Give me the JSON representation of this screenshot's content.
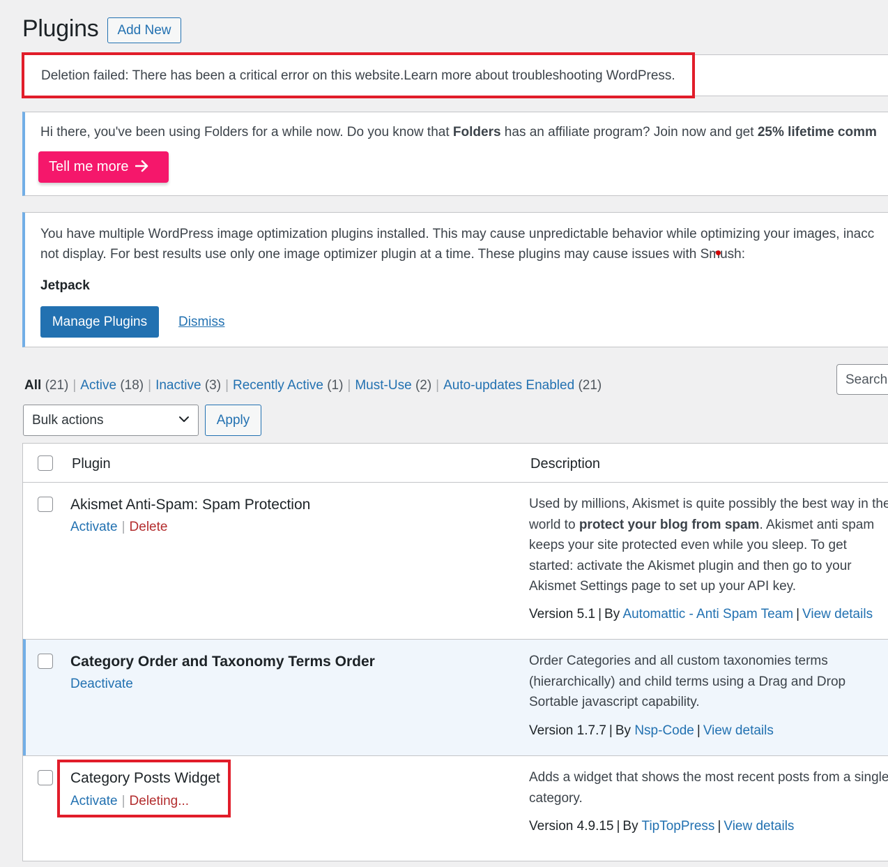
{
  "header": {
    "title": "Plugins",
    "add_new": "Add New"
  },
  "notices": {
    "error": {
      "text": "Deletion failed: There has been a critical error on this website.Learn more about troubleshooting WordPress."
    },
    "folders": {
      "text_a": "Hi there, you've been using Folders for a while now. Do you know that ",
      "text_bold_a": "Folders",
      "text_b": " has an affiliate program? Join now and get ",
      "text_bold_b": "25% lifetime comm",
      "button": "Tell me more",
      "button_icon": "arrow-right-icon"
    },
    "smush": {
      "line1": "You have multiple WordPress image optimization plugins installed. This may cause unpredictable behavior while optimizing your images, inacc",
      "line2": "not display. For best results use only one image optimizer plugin at a time. These plugins may cause issues with Smush:",
      "plugin": "Jetpack",
      "manage_button": "Manage Plugins",
      "dismiss": "Dismiss"
    }
  },
  "filters": {
    "all": {
      "label": "All",
      "count": "(21)"
    },
    "active": {
      "label": "Active",
      "count": "(18)"
    },
    "inactive": {
      "label": "Inactive",
      "count": "(3)"
    },
    "recent": {
      "label": "Recently Active",
      "count": "(1)"
    },
    "mustuse": {
      "label": "Must-Use",
      "count": "(2)"
    },
    "autoupd": {
      "label": "Auto-updates Enabled",
      "count": "(21)"
    }
  },
  "search": {
    "placeholder": "Search"
  },
  "bulk": {
    "selected": "Bulk actions",
    "apply": "Apply"
  },
  "table": {
    "col_plugin": "Plugin",
    "col_description": "Description",
    "rows": [
      {
        "name": "Akismet Anti-Spam: Spam Protection",
        "action1": "Activate",
        "action2": "Delete",
        "desc_a": "Used by millions, Akismet is quite possibly the best way in the world to ",
        "desc_bold": "protect your blog from spam",
        "desc_b": ". Akismet anti spam keeps your site protected even while you sleep. To get started: activate the Akismet plugin and then go to your Akismet Settings page to set up your API key.",
        "version": "Version 5.1",
        "by": "By",
        "author": "Automattic - Anti Spam Team",
        "details": "View details"
      },
      {
        "name": "Category Order and Taxonomy Terms Order",
        "action1": "Deactivate",
        "desc": "Order Categories and all custom taxonomies terms (hierarchically) and child terms using a Drag and Drop Sortable javascript capability.",
        "version": "Version 1.7.7",
        "by": "By",
        "author": "Nsp-Code",
        "details": "View details"
      },
      {
        "name": "Category Posts Widget",
        "action1": "Activate",
        "action2": "Deleting...",
        "desc": "Adds a widget that shows the most recent posts from a single category.",
        "version": "Version 4.9.15",
        "by": "By",
        "author": "TipTopPress",
        "details": "View details"
      }
    ]
  },
  "colors": {
    "link": "#2271b1",
    "delete": "#b32d2e",
    "highlight": "#e11d2a",
    "folders_button": "#f5176b",
    "notice_border": "#72aee6"
  }
}
